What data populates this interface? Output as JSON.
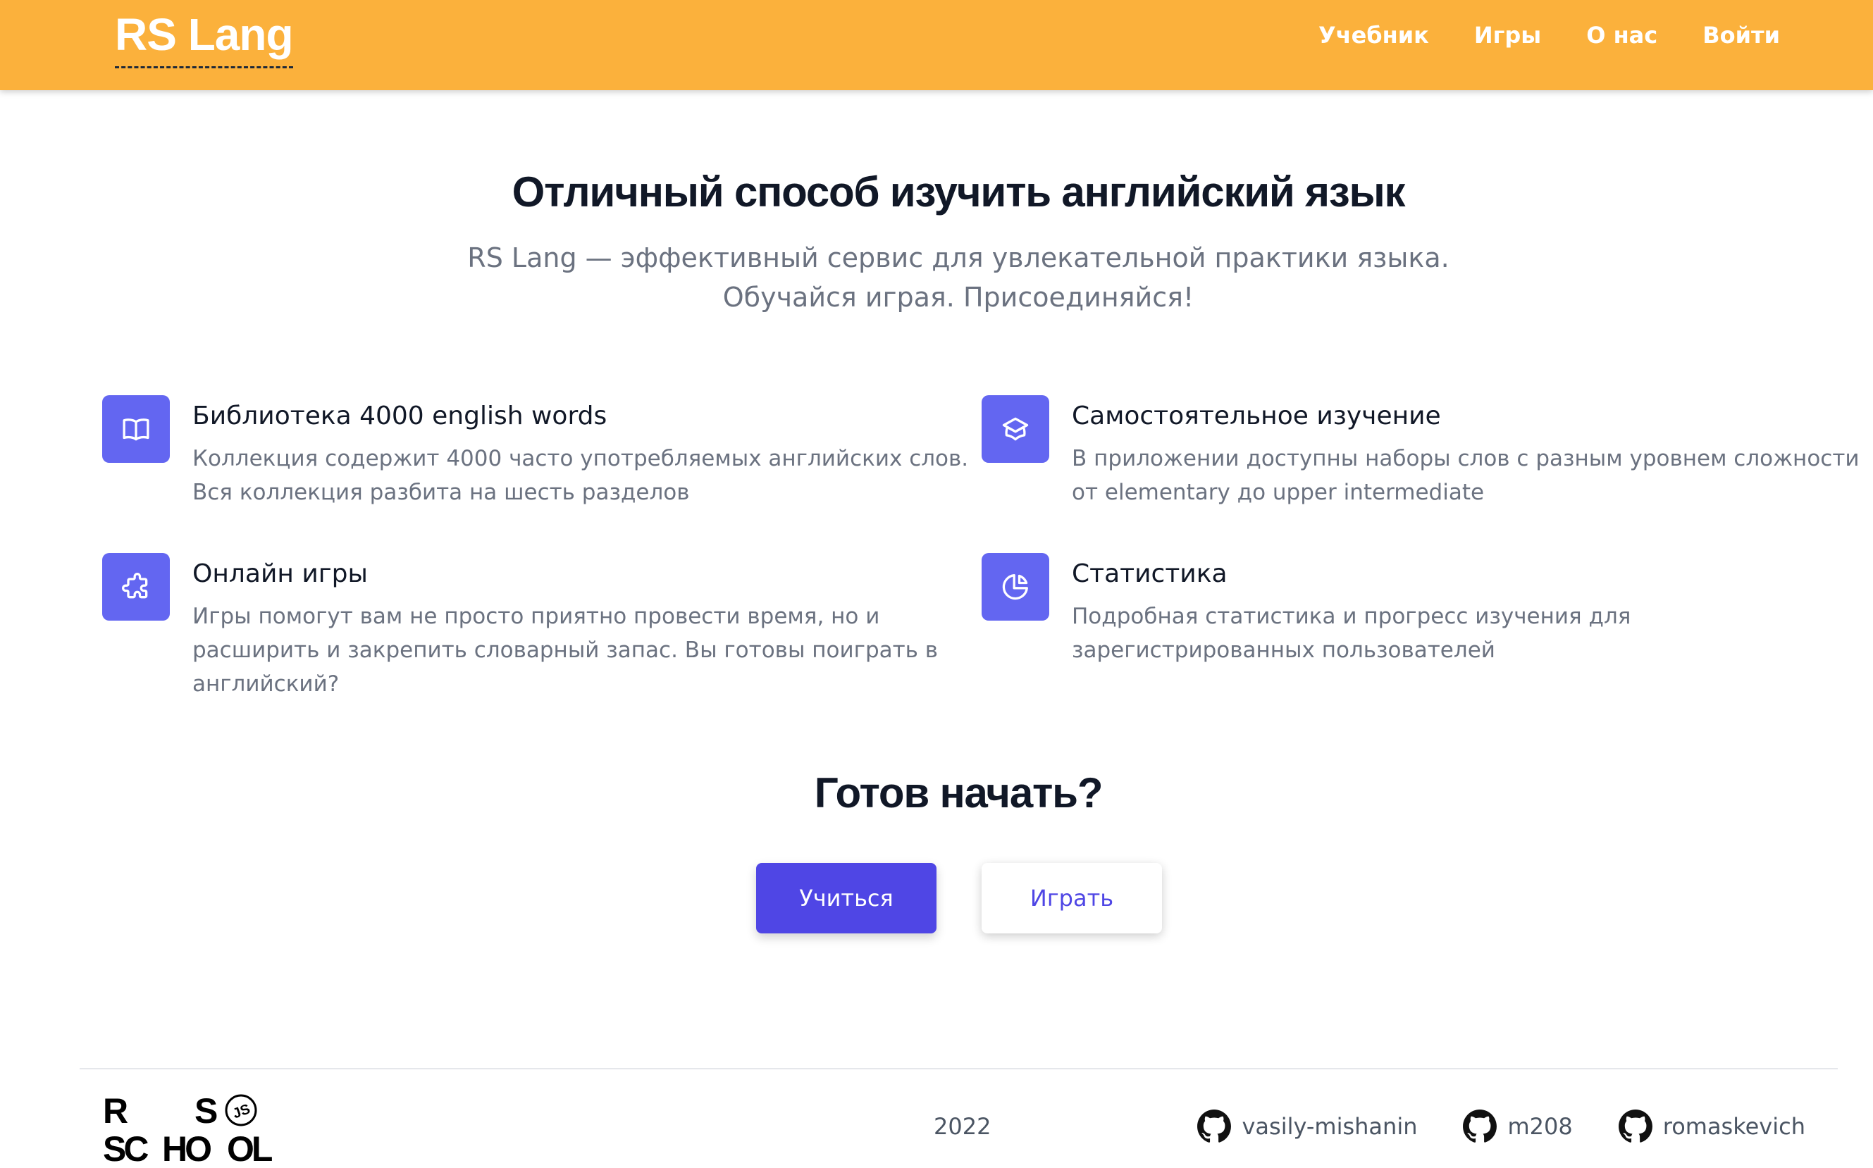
{
  "header": {
    "logo": "RS Lang",
    "nav": [
      "Учебник",
      "Игры",
      "О нас",
      "Войти"
    ]
  },
  "hero": {
    "title": "Отличный способ изучить английский язык",
    "subtitle_line1": "RS Lang — эффективный сервис для увлекательной практики языка.",
    "subtitle_line2": "Обучайся играя. Присоединяйся!"
  },
  "features": [
    {
      "icon": "book-open-icon",
      "title": "Библиотека 4000 english words",
      "text": "Коллекция содержит 4000 часто употребляемых английских слов. Вся коллекция разбита на шесть разделов"
    },
    {
      "icon": "graduation-cap-icon",
      "title": "Самостоятельное изучение",
      "text": "В приложении доступны наборы слов с разным уровнем сложности от elementary до upper intermediate"
    },
    {
      "icon": "puzzle-icon",
      "title": "Онлайн игры",
      "text": "Игры помогут вам не просто приятно провести время, но и расширить и закрепить словарный запас. Вы готовы поиграть в английский?"
    },
    {
      "icon": "pie-chart-icon",
      "title": "Статистика",
      "text": "Подробная статистика и прогресс изучения для зарегистрированных пользователей"
    }
  ],
  "cta": {
    "title": "Готов начать?",
    "primary": "Учиться",
    "secondary": "Играть"
  },
  "footer": {
    "logo_letters": [
      "R",
      "S",
      "SC",
      "HO",
      "OL",
      "JS"
    ],
    "year": "2022",
    "authors": [
      "vasily-mishanin",
      "m208",
      "romaskevich"
    ]
  },
  "colors": {
    "header_bg": "#fbb13c",
    "accent": "#4f46e5",
    "icon_bg": "#6366f1",
    "muted_text": "#6b7280"
  }
}
